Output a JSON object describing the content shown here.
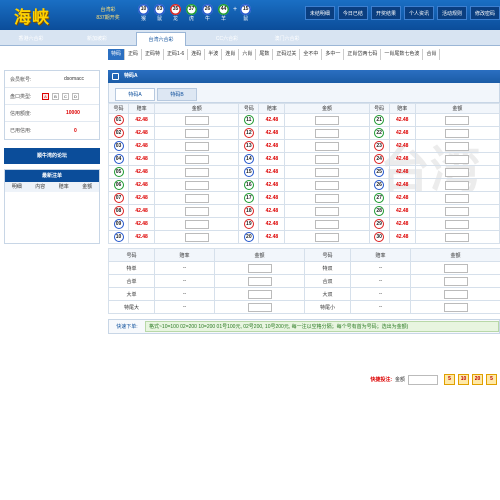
{
  "header": {
    "logo": "海峡",
    "lottery_line1": "台湾彩",
    "lottery_line2": "837期开奖",
    "balls": [
      {
        "num": "10",
        "zodiac": "猴",
        "color": "#2255cc"
      },
      {
        "num": "03",
        "zodiac": "鼠",
        "color": "#2255cc"
      },
      {
        "num": "35",
        "zodiac": "龙",
        "color": "#d22222"
      },
      {
        "num": "37",
        "zodiac": "虎",
        "color": "#1a9a2e"
      },
      {
        "num": "26",
        "zodiac": "牛",
        "color": "#2255cc"
      },
      {
        "num": "44",
        "zodiac": "羊",
        "color": "#1a9a2e"
      }
    ],
    "plus": "+",
    "special_ball": {
      "num": "15",
      "zodiac": "鼠",
      "color": "#2255cc"
    },
    "nav": [
      "未结明细",
      "今日已结",
      "开奖结果",
      "个人资讯",
      "活动规则",
      "修改密码"
    ]
  },
  "game_tabs": [
    "香港六合彩",
    "新加坡彩",
    "台湾六合彩",
    "CC六合彩",
    "澳门六合彩"
  ],
  "active_game": 2,
  "sub_tabs": [
    "特码",
    "正码",
    "正码特",
    "正码1-6",
    "连码",
    "半波",
    "连肖",
    "六肖",
    "尾数",
    "正码过关",
    "全不中",
    "多中一",
    "正肖岱两七码",
    "一肖尾数七色波",
    "合肖"
  ],
  "sidebar": {
    "account_label": "会员帐号:",
    "account_value": "dsomacc",
    "pan_label": "盘口类型:",
    "pan_options": [
      "A",
      "B",
      "C",
      "D"
    ],
    "credit_label": "信用额度:",
    "credit_value": "10000",
    "used_label": "已用信用:",
    "used_value": "0",
    "forum_button": "顺牛湾的论坛",
    "recent_title": "最新注单",
    "recent_cols": [
      "明细",
      "内容",
      "赔率",
      "金额"
    ]
  },
  "panel": {
    "title": "特码A",
    "tabs": [
      "特码A",
      "特码B"
    ],
    "col_headers": [
      "号码",
      "赔率",
      "金额"
    ],
    "odds": "42.48",
    "numbers": [
      {
        "n": "01",
        "c": "r"
      },
      {
        "n": "02",
        "c": "r"
      },
      {
        "n": "03",
        "c": "b"
      },
      {
        "n": "04",
        "c": "b"
      },
      {
        "n": "05",
        "c": "g"
      },
      {
        "n": "06",
        "c": "g"
      },
      {
        "n": "07",
        "c": "r"
      },
      {
        "n": "08",
        "c": "r"
      },
      {
        "n": "09",
        "c": "b"
      },
      {
        "n": "10",
        "c": "b"
      },
      {
        "n": "11",
        "c": "g"
      },
      {
        "n": "12",
        "c": "r"
      },
      {
        "n": "13",
        "c": "r"
      },
      {
        "n": "14",
        "c": "b"
      },
      {
        "n": "15",
        "c": "b"
      },
      {
        "n": "16",
        "c": "g"
      },
      {
        "n": "17",
        "c": "g"
      },
      {
        "n": "18",
        "c": "r"
      },
      {
        "n": "19",
        "c": "r"
      },
      {
        "n": "20",
        "c": "b"
      },
      {
        "n": "21",
        "c": "g"
      },
      {
        "n": "22",
        "c": "g"
      },
      {
        "n": "23",
        "c": "r"
      },
      {
        "n": "24",
        "c": "r"
      },
      {
        "n": "25",
        "c": "b"
      },
      {
        "n": "26",
        "c": "b"
      },
      {
        "n": "27",
        "c": "g"
      },
      {
        "n": "28",
        "c": "g"
      },
      {
        "n": "29",
        "c": "r"
      },
      {
        "n": "30",
        "c": "r"
      }
    ]
  },
  "extra": {
    "col_headers": [
      "号码",
      "赔率",
      "金额"
    ],
    "rows": [
      {
        "a": "特单",
        "a_odds": "--",
        "b": "特双",
        "b_odds": "--"
      },
      {
        "a": "合单",
        "a_odds": "--",
        "b": "合双",
        "b_odds": "--"
      },
      {
        "a": "大单",
        "a_odds": "--",
        "b": "大双",
        "b_odds": "--"
      },
      {
        "a": "特尾大",
        "a_odds": "--",
        "b": "特尾小",
        "b_odds": "--"
      }
    ]
  },
  "quick": {
    "label": "快速下单:",
    "hint": "格式~10=100 02=200 10=200 01号100元, 02号200, 10号200元, 每一注以空格分隔；每个号有首为号码；选出为金额)"
  },
  "bottom": {
    "quick_label": "快捷投注:",
    "amount_label": "金额",
    "chips": [
      "5",
      "10",
      "20",
      "5"
    ]
  },
  "watermark": "台湾"
}
